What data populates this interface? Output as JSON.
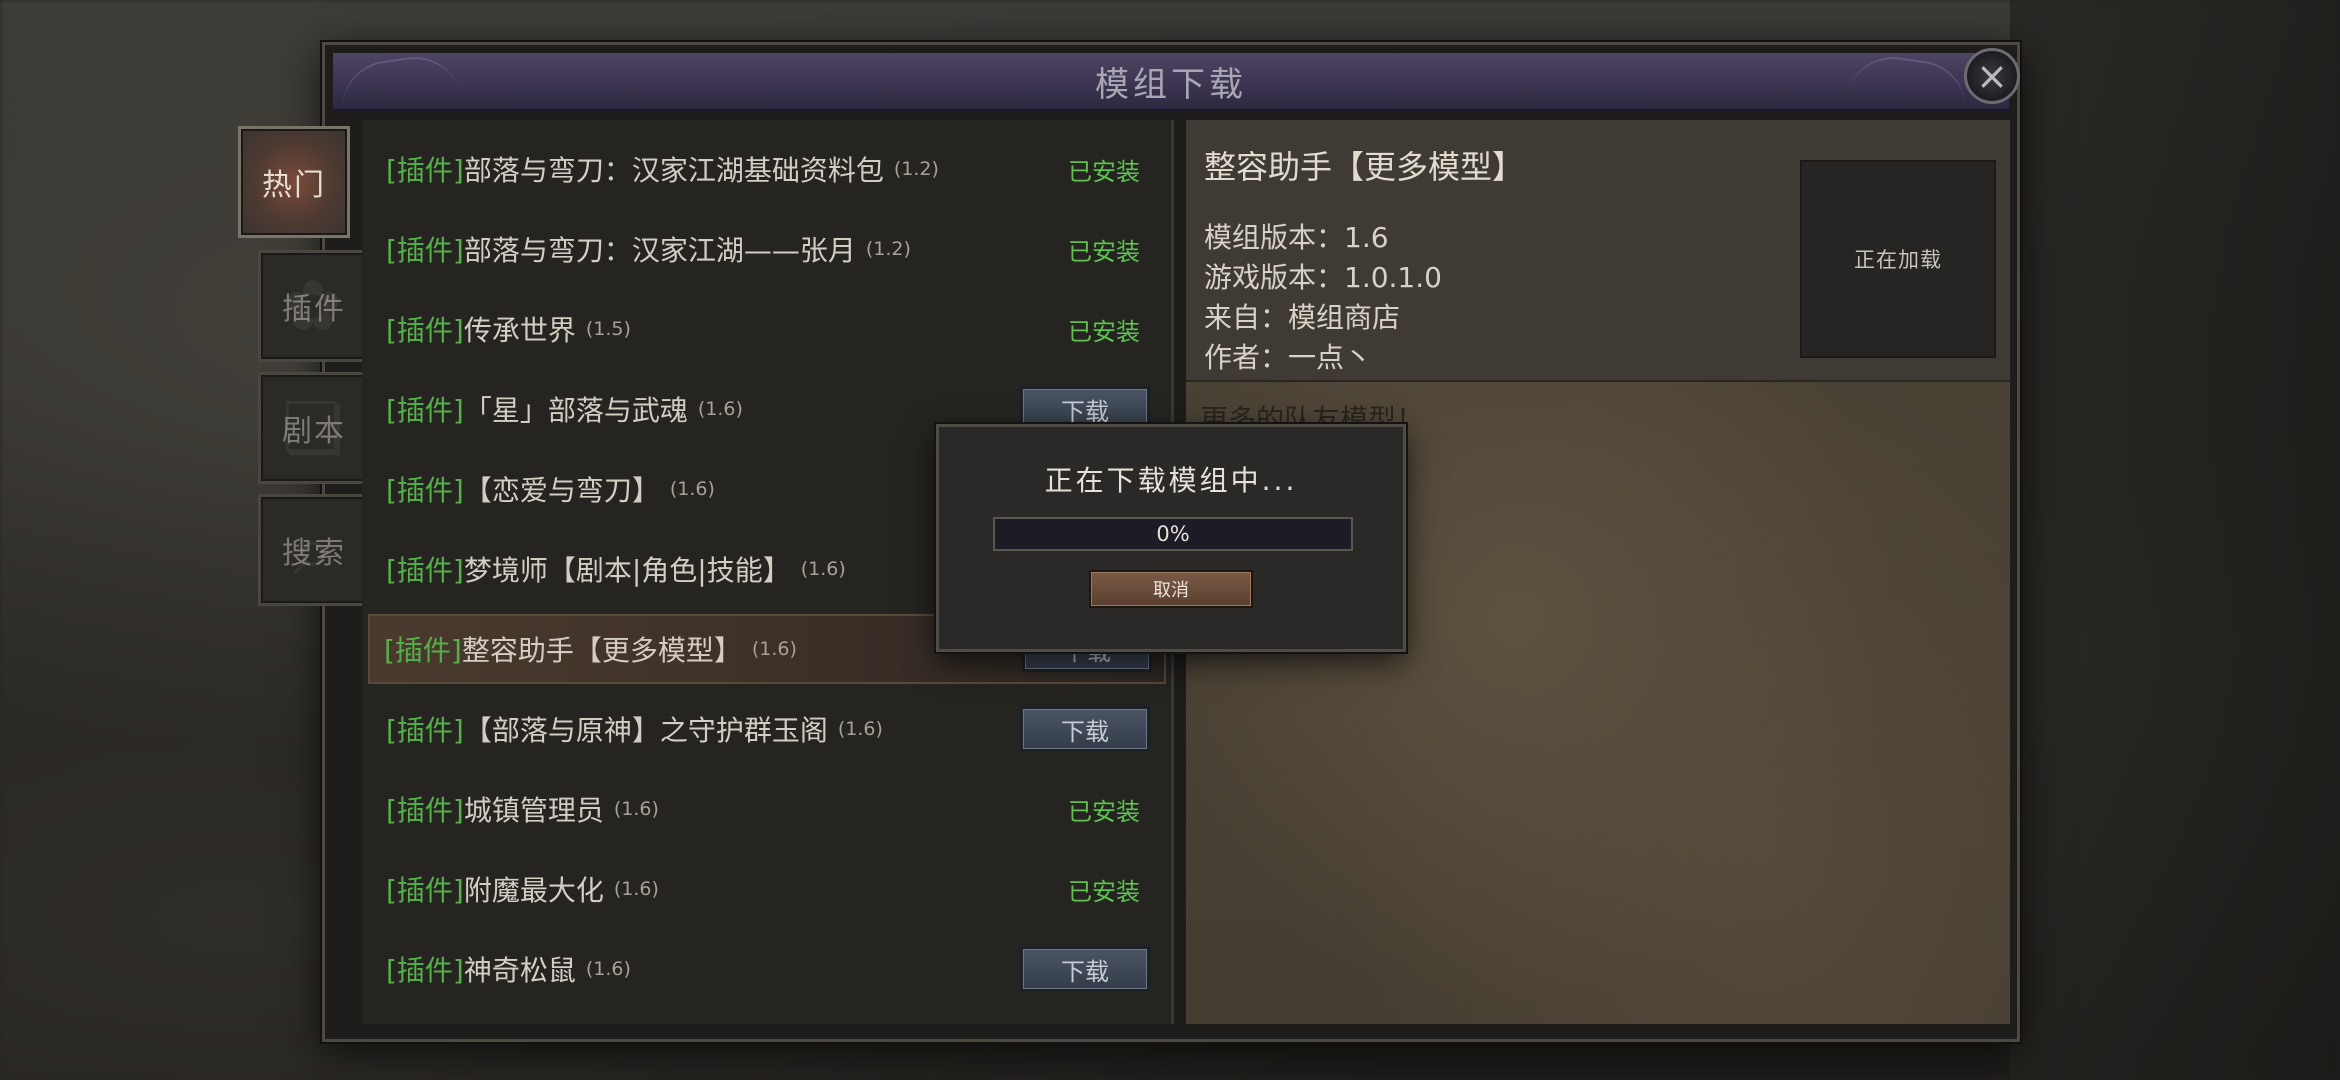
{
  "window": {
    "title": "模组下载"
  },
  "tabs": [
    {
      "label": "热门",
      "active": true
    },
    {
      "label": "插件",
      "active": false
    },
    {
      "label": "剧本",
      "active": false
    },
    {
      "label": "搜索",
      "active": false
    }
  ],
  "mods": [
    {
      "tag": "[插件]",
      "name": "部落与弯刀：汉家江湖基础资料包",
      "version": "(1.2)",
      "status": "已安装"
    },
    {
      "tag": "[插件]",
      "name": "部落与弯刀：汉家江湖——张月",
      "version": "(1.2)",
      "status": "已安装"
    },
    {
      "tag": "[插件]",
      "name": "传承世界",
      "version": "(1.5)",
      "status": "已安装"
    },
    {
      "tag": "[插件]",
      "name": "「星」部落与武魂",
      "version": "(1.6)",
      "status": "下载"
    },
    {
      "tag": "[插件]",
      "name": "【恋爱与弯刀】",
      "version": "(1.6)",
      "status": ""
    },
    {
      "tag": "[插件]",
      "name": "梦境师【剧本|角色|技能】",
      "version": "(1.6)",
      "status": ""
    },
    {
      "tag": "[插件]",
      "name": "整容助手【更多模型】",
      "version": "(1.6)",
      "status": "下载"
    },
    {
      "tag": "[插件]",
      "name": "【部落与原神】之守护群玉阁",
      "version": "(1.6)",
      "status": "下载"
    },
    {
      "tag": "[插件]",
      "name": "城镇管理员",
      "version": "(1.6)",
      "status": "已安装"
    },
    {
      "tag": "[插件]",
      "name": "附魔最大化",
      "version": "(1.6)",
      "status": "已安装"
    },
    {
      "tag": "[插件]",
      "name": "神奇松鼠",
      "version": "(1.6)",
      "status": "下载"
    }
  ],
  "detail": {
    "title": "整容助手【更多模型】",
    "mod_version": "模组版本：1.6",
    "game_version": "游戏版本：1.0.1.0",
    "source": "来自：模组商店",
    "author": "作者：一点丶",
    "preview_text": "正在加载",
    "description": "更多的队友模型！"
  },
  "modal": {
    "title": "正在下载模组中...",
    "progress": 0,
    "progress_text": "0%",
    "cancel_label": "取消"
  },
  "colors": {
    "tag_green": "#56b04a",
    "installed_green": "#5ec24e",
    "title_bar": "#3b3350"
  }
}
